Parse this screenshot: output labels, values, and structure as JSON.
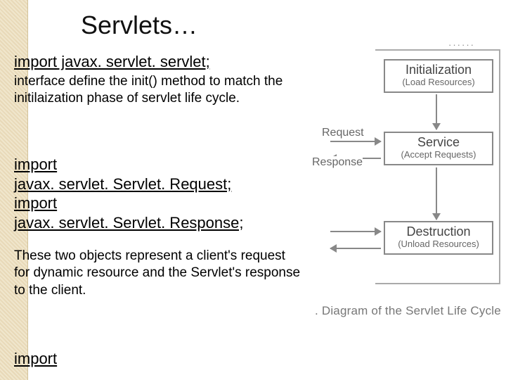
{
  "title": "Servlets…",
  "block1": {
    "heading": "import javax. servlet. servlet;",
    "body": "interface define the init() method to match the initilaization phase  of servlet life cycle."
  },
  "block2": {
    "line1": "import",
    "line2": "javax. servlet. Servlet. Request;",
    "line3": "import",
    "line4": "javax. servlet. Servlet. Response;"
  },
  "block3": {
    "body": "These two objects represent a client's request for dynamic resource and the Servlet's response to the client."
  },
  "block4": {
    "heading": "import"
  },
  "diagram": {
    "server_label": "······",
    "init": {
      "title": "Initialization",
      "sub": "(Load Resources)"
    },
    "service": {
      "title": "Service",
      "sub": "(Accept Requests)"
    },
    "destroy": {
      "title": "Destruction",
      "sub": "(Unload Resources)"
    },
    "request_label": "Request",
    "response_label": "Response",
    "caption": ".  Diagram of the Servlet Life Cycle"
  }
}
